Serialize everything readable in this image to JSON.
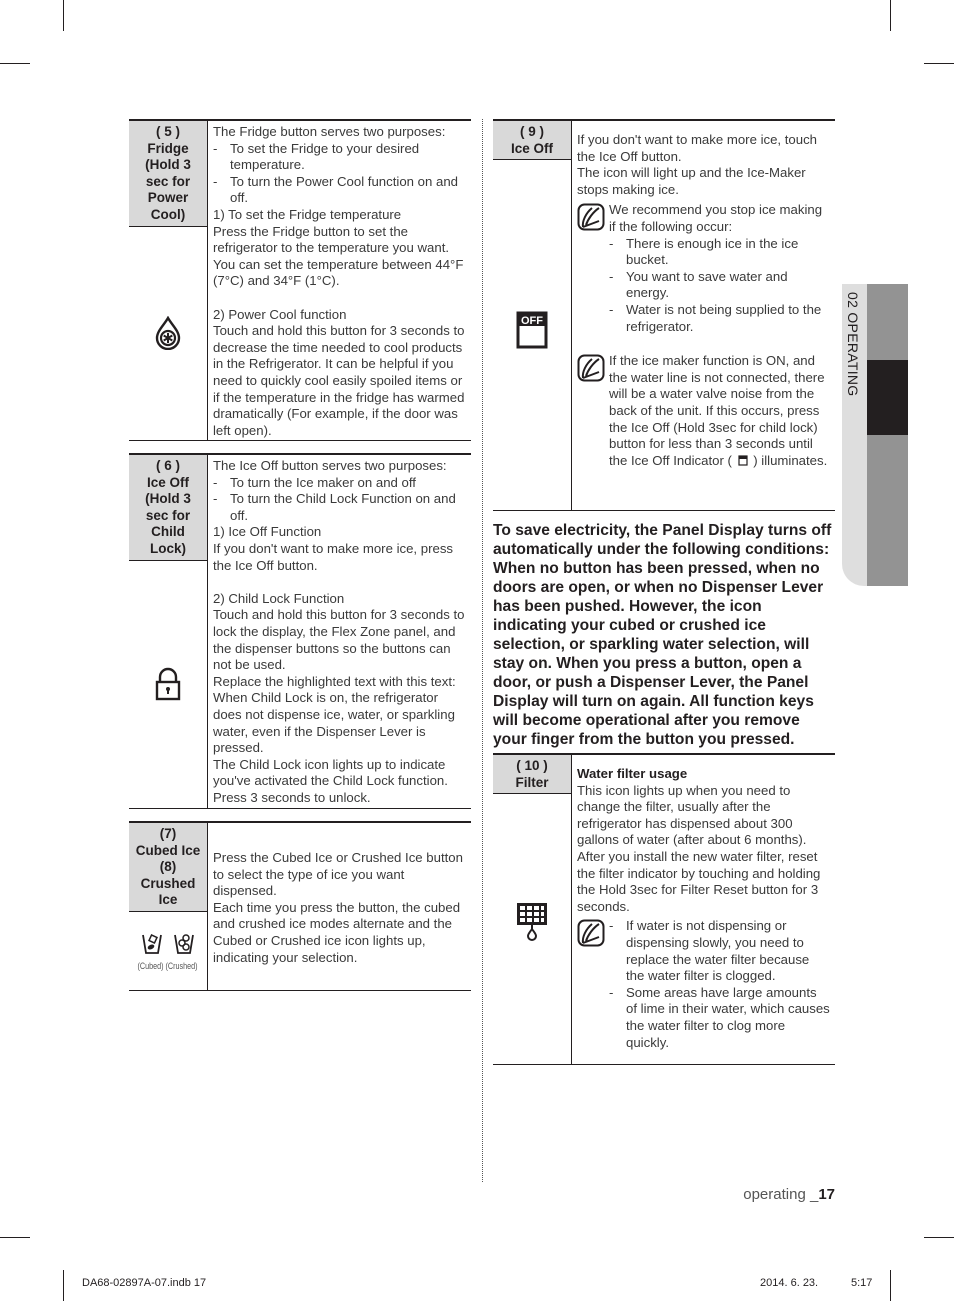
{
  "side_tab": {
    "label": "02  OPERATING"
  },
  "left_column": {
    "fridge": {
      "label_lines": [
        "( 5 )",
        "Fridge",
        "(Hold 3",
        "sec for",
        "Power",
        "Cool)"
      ],
      "icon": "power-cool-drop-icon",
      "lines": [
        {
          "type": "p",
          "text": "The Fridge button serves two purposes:"
        },
        {
          "type": "bullet",
          "text": "To set the Fridge to your desired temperature."
        },
        {
          "type": "bullet",
          "text": "To turn the Power Cool function on and off."
        },
        {
          "type": "p",
          "text": "1) To set the Fridge temperature"
        },
        {
          "type": "p",
          "text": "Press the Fridge button to set the refrigerator to the temperature you want. You can set the temperature between 44°F (7°C) and 34°F (1°C)."
        },
        {
          "type": "blank",
          "text": ""
        },
        {
          "type": "p",
          "text": "2) Power Cool function"
        },
        {
          "type": "p",
          "text": "Touch and hold this button for 3 seconds to decrease the time needed to cool products in the Refrigerator. It can be helpful if you need to quickly cool easily spoiled items or if the temperature in the fridge has warmed dramatically (For example, if the door was left open)."
        }
      ]
    },
    "ice_off_lock": {
      "label_lines": [
        "( 6 )",
        "Ice Off",
        "(Hold 3",
        "sec for",
        "Child",
        "Lock)"
      ],
      "icon": "lock-icon",
      "lines": [
        {
          "type": "p",
          "text": "The Ice Off button serves two purposes:"
        },
        {
          "type": "bullet",
          "text": "To turn the Ice maker on and off"
        },
        {
          "type": "bullet",
          "text": "To turn the Child Lock Function on and off."
        },
        {
          "type": "p",
          "text": "1) Ice Off Function"
        },
        {
          "type": "p",
          "text": "If you don't want to make more ice, press the Ice Off button."
        },
        {
          "type": "blank",
          "text": ""
        },
        {
          "type": "p",
          "text": "2) Child Lock Function"
        },
        {
          "type": "p",
          "text": "Touch and hold this button for 3 seconds to lock the display, the Flex Zone panel, and the dispenser buttons so the buttons can not be used."
        },
        {
          "type": "p",
          "text": "Replace the highlighted text with this text: When Child Lock is on, the refrigerator does not dispense ice, water, or sparkling water, even if the Dispenser Lever is pressed."
        },
        {
          "type": "p",
          "text": "The Child Lock icon lights up to indicate you've activated the Child Lock function. Press 3 seconds to unlock."
        }
      ]
    },
    "cubed_crushed": {
      "label_lines": [
        "(7)",
        "Cubed Ice",
        "(8)",
        "Crushed",
        "Ice"
      ],
      "icon_captions": [
        "(Cubed)",
        "(Crushed)"
      ],
      "lines": [
        {
          "type": "p",
          "text": "Press the Cubed Ice or Crushed Ice button to select the type of ice you want dispensed."
        },
        {
          "type": "p",
          "text": "Each time you press the button, the cubed and crushed ice modes alternate and the Cubed or Crushed ice icon lights up, indicating your selection."
        }
      ]
    }
  },
  "right_column": {
    "ice_off": {
      "label_lines": [
        "( 9 )",
        "Ice Off"
      ],
      "icon_text": "OFF",
      "intro": [
        "If you don't want to make more ice, touch the Ice Off button.",
        "The icon will light up and the Ice-Maker stops making ice."
      ],
      "note1": {
        "text": "We recommend you stop ice making if the following occur:",
        "bullets": [
          "There is enough ice in the ice bucket.",
          "You want to save water and energy.",
          "Water is not being supplied to the refrigerator."
        ]
      },
      "note2": {
        "text_before": "If the ice maker function is ON, and the water line is not connected, there will be a water valve noise from the back of the unit. If this occurs, press the Ice Off (Hold 3sec for child lock) button for less than 3 seconds until the Ice Off Indicator (",
        "text_after": ") illuminates."
      }
    },
    "panel_paragraph": "To save electricity, the Panel Display turns off automatically under the following conditions: When no button has been pressed, when no doors are open, or when no Dispenser Lever has been pushed. However, the icon indicating your cubed or crushed ice selection, or sparkling water selection, will stay on. When you press a button, open a door, or push a Dispenser Lever, the Panel Display will turn on again. All function keys will  become operational after you remove your finger from the button you pressed.",
    "filter": {
      "label_lines": [
        "( 10 )",
        "Filter"
      ],
      "heading": "Water filter usage",
      "body": "This icon lights up when you need to change the filter, usually after the refrigerator has dispensed about 300 gallons of water (after about 6 months). After you install the new water filter, reset the filter indicator by touching and holding the Hold 3sec for Filter Reset button for 3 seconds.",
      "note_bullets": [
        "If water is not dispensing or dispensing slowly, you need to replace the water filter because the water filter is clogged.",
        "Some areas have large amounts of lime in their water, which causes the water filter to clog more quickly."
      ]
    }
  },
  "page_label": {
    "section": "operating _",
    "number": "17"
  },
  "footer": {
    "file": "DA68-02897A-07.indb   17",
    "date": "2014. 6. 23.",
    "time": "5:17"
  }
}
